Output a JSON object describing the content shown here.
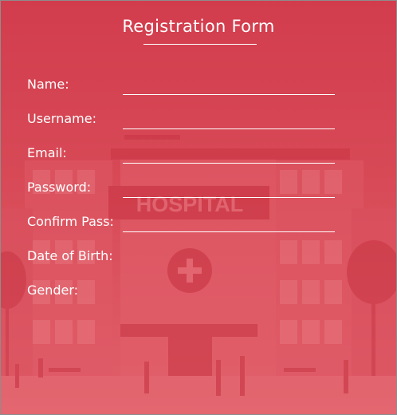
{
  "form": {
    "title": "Registration Form",
    "fields": [
      {
        "label": "Name:",
        "value": "",
        "type": "text"
      },
      {
        "label": "Username:",
        "value": "",
        "type": "text"
      },
      {
        "label": "Email:",
        "value": "",
        "type": "email"
      },
      {
        "label": "Password:",
        "value": "",
        "type": "password"
      },
      {
        "label": "Confirm Pass:",
        "value": "",
        "type": "password"
      },
      {
        "label": "Date of Birth:"
      },
      {
        "label": "Gender:"
      }
    ]
  },
  "background": {
    "sign_text": "HOSPITAL",
    "icon": "hospital-building-icon",
    "colors": {
      "base": "#d23d4d",
      "building": "#e05d69",
      "accent": "#c93544"
    }
  }
}
